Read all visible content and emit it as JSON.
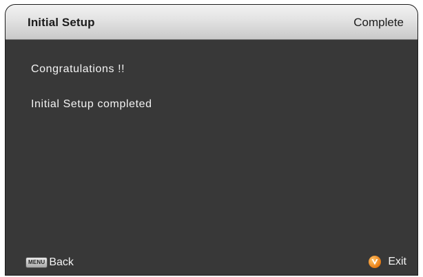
{
  "header": {
    "title": "Initial Setup",
    "status": "Complete"
  },
  "content": {
    "line1": "Congratulations !!",
    "line2": "Initial Setup completed"
  },
  "footer": {
    "back_key_label": "MENU",
    "back_label": "Back",
    "exit_icon": "vizio-v-icon",
    "exit_label": "Exit"
  },
  "colors": {
    "panel_background": "#383838",
    "titlebar_top": "#f2f2f2",
    "titlebar_bottom": "#c9c9c9",
    "text": "#f4f4f4",
    "exit_icon_accent": "#e87b12"
  }
}
